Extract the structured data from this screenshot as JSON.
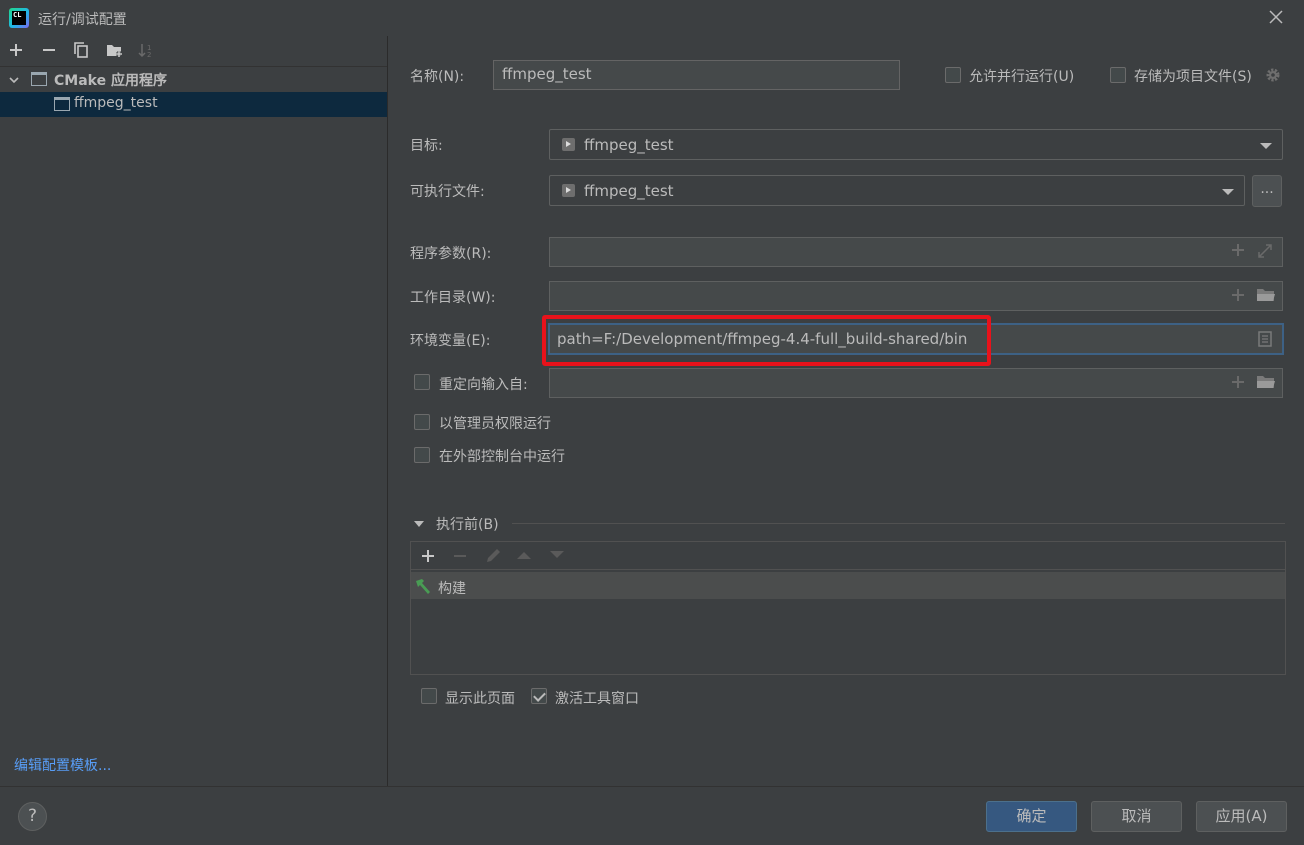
{
  "window": {
    "title": "运行/调试配置",
    "app_icon_text": "CL"
  },
  "sidebar": {
    "toolbar": [
      "add-icon",
      "remove-icon",
      "copy-icon",
      "folder-add-icon",
      "sort-icon"
    ],
    "tree": {
      "group_label": "CMake 应用程序",
      "items": [
        {
          "label": "ffmpeg_test",
          "selected": true
        }
      ]
    },
    "edit_templates_link": "编辑配置模板..."
  },
  "form": {
    "name_label": "名称(N):",
    "name_value": "ffmpeg_test",
    "allow_parallel_label": "允许并行运行(U)",
    "store_as_project_file_label": "存储为项目文件(S)",
    "target_label": "目标:",
    "target_value": "ffmpeg_test",
    "executable_label": "可执行文件:",
    "executable_value": "ffmpeg_test",
    "browse_button_label": "...",
    "program_args_label": "程序参数(R):",
    "program_args_value": "",
    "working_dir_label": "工作目录(W):",
    "working_dir_value": "",
    "env_label": "环境变量(E):",
    "env_value": "path=F:/Development/ffmpeg-4.4-full_build-shared/bin",
    "redirect_input_label": "重定向输入自:",
    "redirect_input_value": "",
    "run_as_admin_label": "以管理员权限运行",
    "run_in_external_console_label": "在外部控制台中运行"
  },
  "before_launch": {
    "section_label": "执行前(B)",
    "toolbar": [
      "add-icon",
      "remove-icon",
      "edit-icon",
      "move-up-icon",
      "move-down-icon"
    ],
    "tasks": [
      {
        "label": "构建",
        "icon": "hammer-icon"
      }
    ],
    "show_page_label": "显示此页面",
    "activate_tool_window_label": "激活工具窗口"
  },
  "footer": {
    "help_label": "?",
    "ok_label": "确定",
    "cancel_label": "取消",
    "apply_label": "应用(A)"
  },
  "checkboxes": {
    "allow_parallel": false,
    "store_as_project_file": false,
    "redirect_input": false,
    "run_as_admin": false,
    "run_in_external_console": false,
    "show_page": false,
    "activate_tool_window": true
  },
  "colors": {
    "background": "#3c3f41",
    "selection": "#0d293e",
    "accent": "#365880",
    "link": "#589df6",
    "highlight_box": "#e8121b",
    "build_icon": "#499c54"
  }
}
